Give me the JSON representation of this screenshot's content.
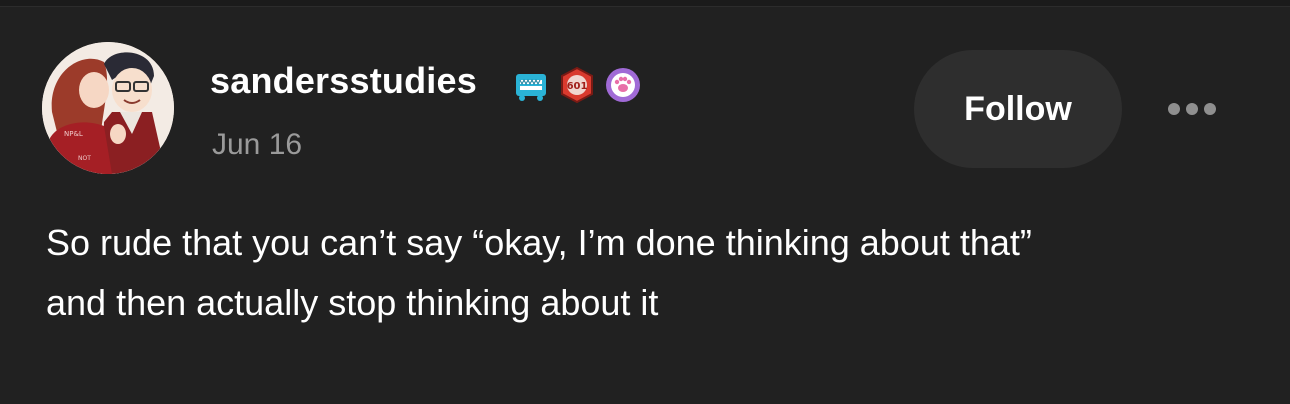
{
  "post": {
    "author": {
      "username": "sandersstudies",
      "avatar": "avatar-illustration-couple",
      "badges": [
        {
          "name": "monster-teeth-badge",
          "color": "#2ab3d6"
        },
        {
          "name": "hexagon-601-badge",
          "color": "#d93a2e",
          "text": "601"
        },
        {
          "name": "paw-badge",
          "color": "#a06ad6"
        }
      ]
    },
    "date": "Jun 16",
    "follow_label": "Follow",
    "more_icon": "ellipsis-icon",
    "text_lines": [
      "So rude that you can’t say “okay, I’m done thinking about that”",
      "and then actually stop thinking about it"
    ]
  },
  "colors": {
    "background": "#212121",
    "text": "#ffffff",
    "muted": "#9a9a9a",
    "button_bg": "#2e2e2e"
  }
}
